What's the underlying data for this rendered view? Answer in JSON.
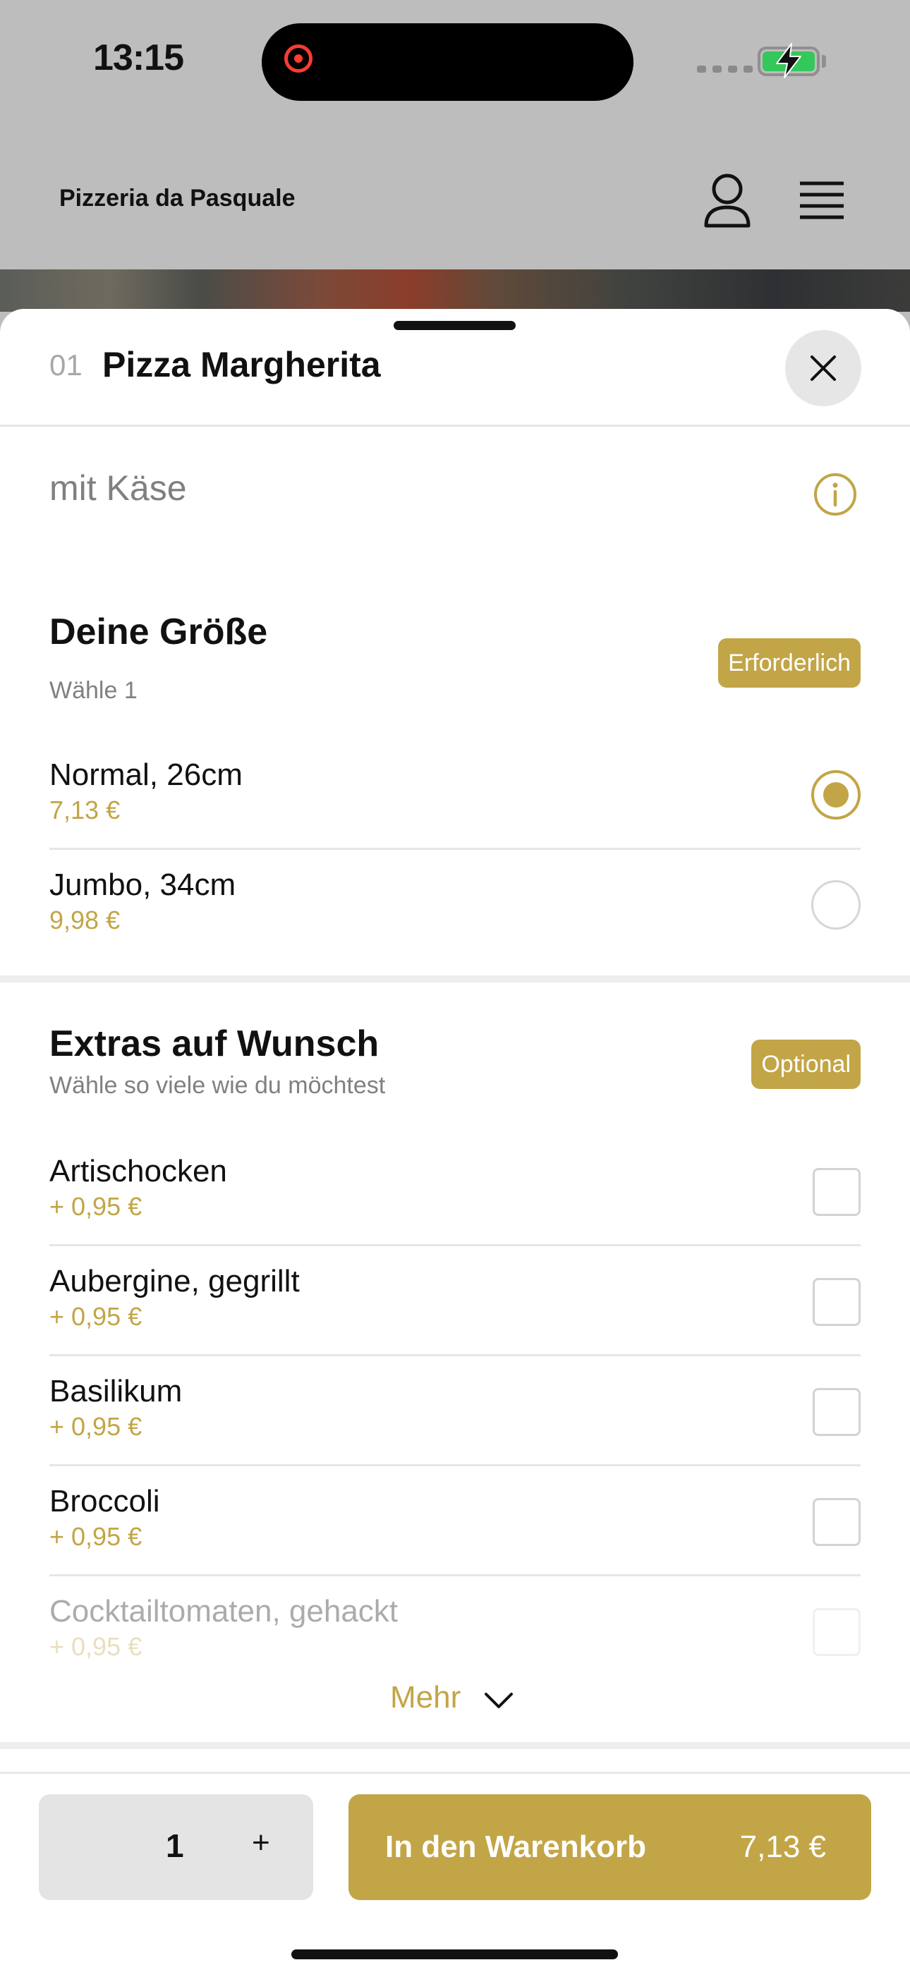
{
  "status_bar": {
    "time": "13:15"
  },
  "header": {
    "title": "Pizzeria da Pasquale"
  },
  "item": {
    "number": "01",
    "title": "Pizza Margherita",
    "description": "mit Käse"
  },
  "size_section": {
    "title": "Deine Größe",
    "subtitle": "Wähle 1",
    "badge": "Erforderlich",
    "options": [
      {
        "name": "Normal, 26cm",
        "price": "7,13 €",
        "selected": true
      },
      {
        "name": "Jumbo, 34cm",
        "price": "9,98 €",
        "selected": false
      }
    ]
  },
  "extras_section": {
    "title": "Extras auf Wunsch",
    "subtitle": "Wähle so viele wie du möchtest",
    "badge": "Optional",
    "options": [
      {
        "name": "Artischocken",
        "price": "+ 0,95 €"
      },
      {
        "name": "Aubergine, gegrillt",
        "price": "+ 0,95 €"
      },
      {
        "name": "Basilikum",
        "price": "+ 0,95 €"
      },
      {
        "name": "Broccoli",
        "price": "+ 0,95 €"
      },
      {
        "name": "Cocktailtomaten, gehackt",
        "price": "+ 0,95 €"
      }
    ],
    "more_label": "Mehr"
  },
  "footer": {
    "quantity": "1",
    "plus_label": "+",
    "cart_label": "In den Warenkorb",
    "cart_price": "7,13 €"
  },
  "colors": {
    "accent": "#c2a547",
    "overlay": "#bdbdbd"
  }
}
